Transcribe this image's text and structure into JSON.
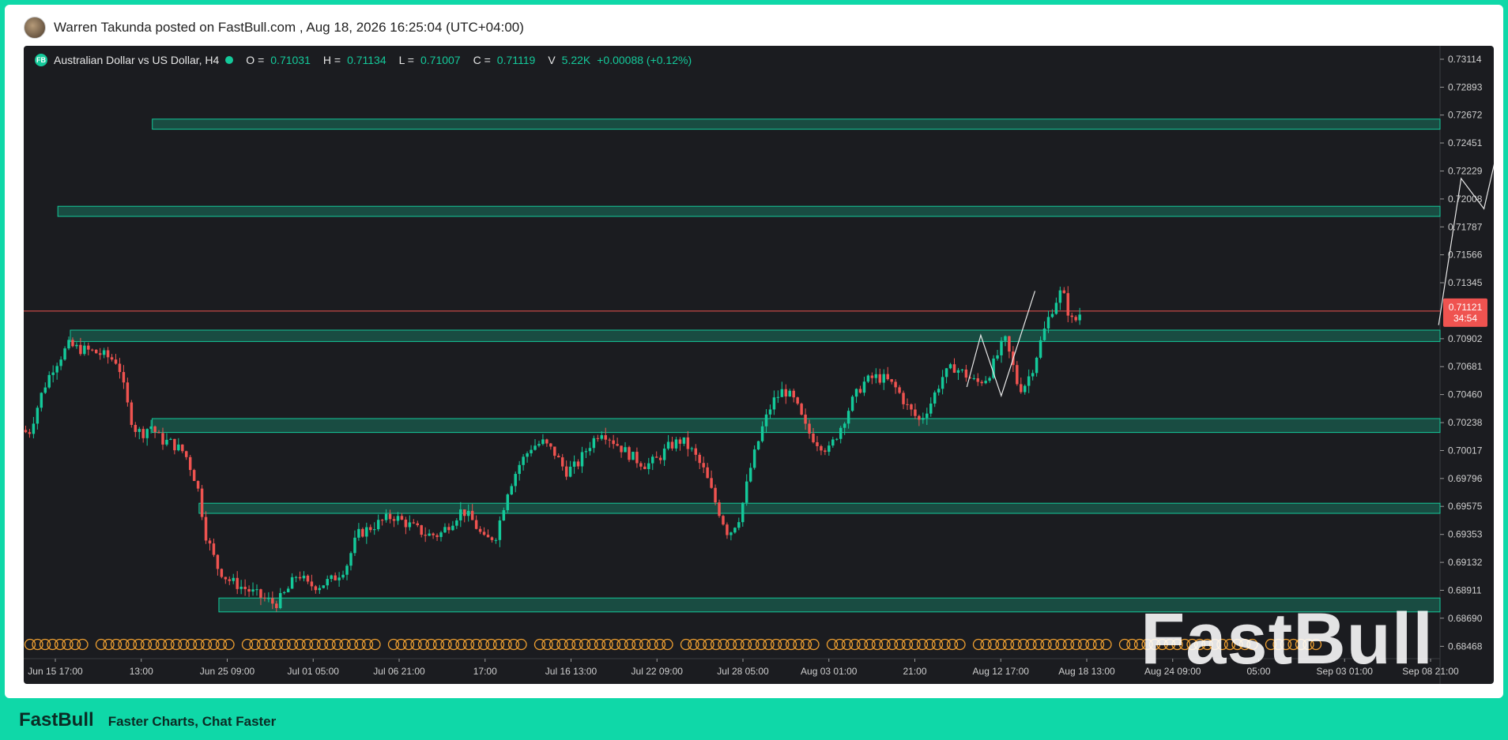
{
  "header": {
    "text": "Warren Takunda posted on FastBull.com ,  Aug 18, 2026 16:25:04 (UTC+04:00)"
  },
  "legend": {
    "logo": "FB",
    "symbol": "Australian Dollar vs US Dollar, H4",
    "open_label": "O =",
    "open": "0.71031",
    "high_label": "H =",
    "high": "0.71134",
    "low_label": "L =",
    "low": "0.71007",
    "close_label": "C =",
    "close": "0.71119",
    "volume_label": "V",
    "volume": "5.22K",
    "change": "+0.00088 (+0.12%)"
  },
  "watermark": "FastBull",
  "footer": {
    "brand": "FastBull",
    "tagline": "Faster Charts, Chat Faster"
  },
  "colors": {
    "accent": "#14c99a",
    "down": "#ef5350",
    "up": "#14c99a",
    "background": "#1b1c20"
  },
  "chart_data": {
    "type": "candlestick",
    "y_ticks": [
      "0.73114",
      "0.72893",
      "0.72672",
      "0.72451",
      "0.72229",
      "0.72008",
      "0.71787",
      "0.71566",
      "0.71345",
      "0.70902",
      "0.70681",
      "0.70460",
      "0.70238",
      "0.70017",
      "0.69796",
      "0.69575",
      "0.69353",
      "0.69132",
      "0.68911",
      "0.68690",
      "0.68468"
    ],
    "ylim": [
      0.6837,
      0.7322
    ],
    "x_ticks": [
      "Jun 15 17:00",
      "13:00",
      "Jun 25 09:00",
      "Jul 01 05:00",
      "Jul 06 21:00",
      "17:00",
      "Jul 16 13:00",
      "Jul 22 09:00",
      "Jul 28 05:00",
      "Aug 03 01:00",
      "21:00",
      "Aug 12 17:00",
      "Aug 18 13:00",
      "Aug 24 09:00",
      "05:00",
      "Sep 03 01:00",
      "Sep 08 21:00"
    ],
    "current_price": {
      "value": "0.71121",
      "countdown": "34:54"
    },
    "zones": [
      {
        "top": 0.7264,
        "bottom": 0.7256,
        "start": 0.0908
      },
      {
        "top": 0.7195,
        "bottom": 0.7187,
        "start": 0.0241
      },
      {
        "top": 0.7097,
        "bottom": 0.7088,
        "start": 0.0329
      },
      {
        "top": 0.7027,
        "bottom": 0.7016,
        "start": 0.0907
      },
      {
        "top": 0.696,
        "bottom": 0.6952,
        "start": 0.1238
      },
      {
        "top": 0.6885,
        "bottom": 0.6874,
        "start": 0.1378
      }
    ],
    "projection": [
      [
        0.999,
        0.7101
      ],
      [
        1.0149,
        0.7217
      ],
      [
        1.031,
        0.7193
      ],
      [
        1.0441,
        0.7257
      ]
    ],
    "zigzag": [
      [
        0.6659,
        0.7052
      ],
      [
        0.6757,
        0.7093
      ],
      [
        0.6902,
        0.7045
      ],
      [
        0.714,
        0.7128
      ]
    ],
    "candle_path": [
      [
        0.0,
        0.7018
      ],
      [
        0.0049,
        0.7015
      ],
      [
        0.015,
        0.705
      ],
      [
        0.0218,
        0.7067
      ],
      [
        0.0329,
        0.7085
      ],
      [
        0.041,
        0.7082
      ],
      [
        0.05,
        0.708
      ],
      [
        0.056,
        0.7078
      ],
      [
        0.062,
        0.7075
      ],
      [
        0.068,
        0.7072
      ],
      [
        0.0741,
        0.704
      ],
      [
        0.079,
        0.702
      ],
      [
        0.085,
        0.7015
      ],
      [
        0.0908,
        0.7022
      ],
      [
        0.098,
        0.701
      ],
      [
        0.105,
        0.7008
      ],
      [
        0.115,
        0.7
      ],
      [
        0.1238,
        0.6975
      ],
      [
        0.13,
        0.6935
      ],
      [
        0.1378,
        0.691
      ],
      [
        0.145,
        0.69
      ],
      [
        0.153,
        0.6895
      ],
      [
        0.162,
        0.689
      ],
      [
        0.17,
        0.6885
      ],
      [
        0.179,
        0.688
      ],
      [
        0.187,
        0.689
      ],
      [
        0.195,
        0.6905
      ],
      [
        0.202,
        0.6895
      ],
      [
        0.21,
        0.6895
      ],
      [
        0.22,
        0.69
      ],
      [
        0.229,
        0.691
      ],
      [
        0.237,
        0.6935
      ],
      [
        0.245,
        0.694
      ],
      [
        0.253,
        0.6945
      ],
      [
        0.262,
        0.695
      ],
      [
        0.27,
        0.6945
      ],
      [
        0.278,
        0.694
      ],
      [
        0.286,
        0.6935
      ],
      [
        0.295,
        0.6935
      ],
      [
        0.303,
        0.6945
      ],
      [
        0.311,
        0.6955
      ],
      [
        0.319,
        0.6945
      ],
      [
        0.327,
        0.693
      ],
      [
        0.335,
        0.6935
      ],
      [
        0.343,
        0.697
      ],
      [
        0.351,
        0.699
      ],
      [
        0.36,
        0.7005
      ],
      [
        0.368,
        0.7008
      ],
      [
        0.376,
        0.7
      ],
      [
        0.384,
        0.6985
      ],
      [
        0.392,
        0.699
      ],
      [
        0.4,
        0.7005
      ],
      [
        0.409,
        0.7018
      ],
      [
        0.417,
        0.701
      ],
      [
        0.425,
        0.7002
      ],
      [
        0.433,
        0.6995
      ],
      [
        0.441,
        0.699
      ],
      [
        0.449,
        0.6995
      ],
      [
        0.457,
        0.7005
      ],
      [
        0.466,
        0.701
      ],
      [
        0.474,
        0.7
      ],
      [
        0.482,
        0.6985
      ],
      [
        0.49,
        0.696
      ],
      [
        0.499,
        0.6935
      ],
      [
        0.507,
        0.695
      ],
      [
        0.515,
        0.699
      ],
      [
        0.523,
        0.702
      ],
      [
        0.53,
        0.704
      ],
      [
        0.538,
        0.705
      ],
      [
        0.546,
        0.704
      ],
      [
        0.554,
        0.7018
      ],
      [
        0.562,
        0.7008
      ],
      [
        0.57,
        0.7002
      ],
      [
        0.578,
        0.702
      ],
      [
        0.586,
        0.704
      ],
      [
        0.594,
        0.7055
      ],
      [
        0.602,
        0.706
      ],
      [
        0.61,
        0.7058
      ],
      [
        0.618,
        0.705
      ],
      [
        0.626,
        0.7035
      ],
      [
        0.634,
        0.7025
      ],
      [
        0.642,
        0.704
      ],
      [
        0.65,
        0.706
      ],
      [
        0.658,
        0.7068
      ],
      [
        0.666,
        0.7062
      ],
      [
        0.674,
        0.7055
      ],
      [
        0.682,
        0.706
      ],
      [
        0.688,
        0.7075
      ],
      [
        0.694,
        0.709
      ],
      [
        0.699,
        0.7072
      ],
      [
        0.704,
        0.705
      ],
      [
        0.709,
        0.7055
      ],
      [
        0.714,
        0.7068
      ],
      [
        0.72,
        0.709
      ],
      [
        0.726,
        0.711
      ],
      [
        0.73,
        0.712
      ],
      [
        0.734,
        0.7128
      ],
      [
        0.737,
        0.712
      ],
      [
        0.74,
        0.7106
      ],
      [
        0.743,
        0.7103
      ],
      [
        0.747,
        0.711
      ]
    ],
    "candle_marks": "row of orange circled-C event markers along the bottom of the chart"
  }
}
